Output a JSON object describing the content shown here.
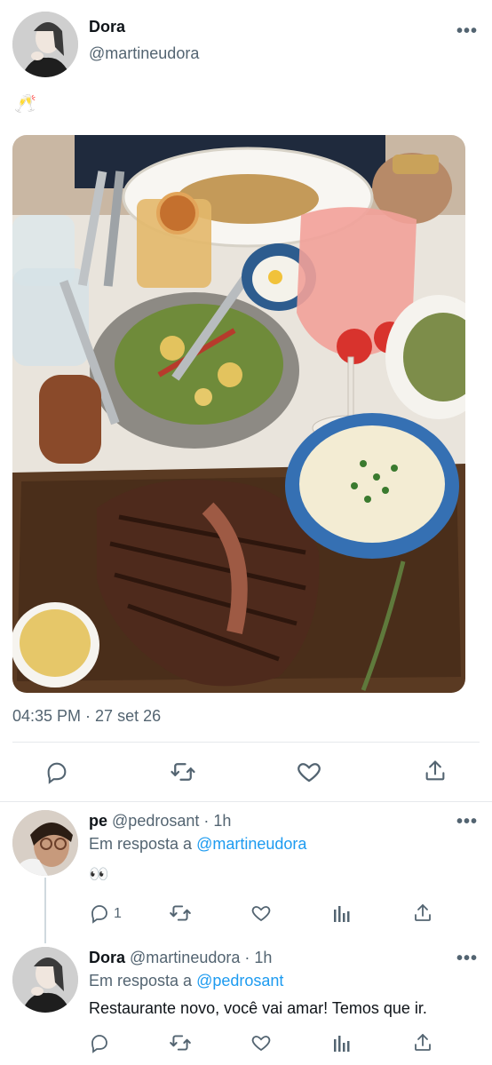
{
  "main_tweet": {
    "author_name": "Dora",
    "author_handle": "@martineudora",
    "text": "🥂",
    "timestamp": "04:35 PM · 27 set 26",
    "more_label": "•••"
  },
  "action_icons": [
    "reply-icon",
    "retweet-icon",
    "like-icon",
    "share-icon"
  ],
  "replies": [
    {
      "author_name": "pe",
      "author_handle": "@pedrosant",
      "time": "· 1h",
      "reply_prefix": "Em resposta a",
      "reply_to": "@martineudora",
      "text": "👀",
      "reply_count": "1",
      "more_label": "•••"
    },
    {
      "author_name": "Dora",
      "author_handle": "@martineudora",
      "time": "· 1h",
      "reply_prefix": "Em resposta a",
      "reply_to": "@pedrosant",
      "text": "Restaurante novo, você vai amar! Temos que ir.",
      "more_label": "•••"
    }
  ],
  "colors": {
    "accent": "#1d9bf0",
    "secondary_text": "#536471",
    "divider": "#e6e9ec"
  }
}
